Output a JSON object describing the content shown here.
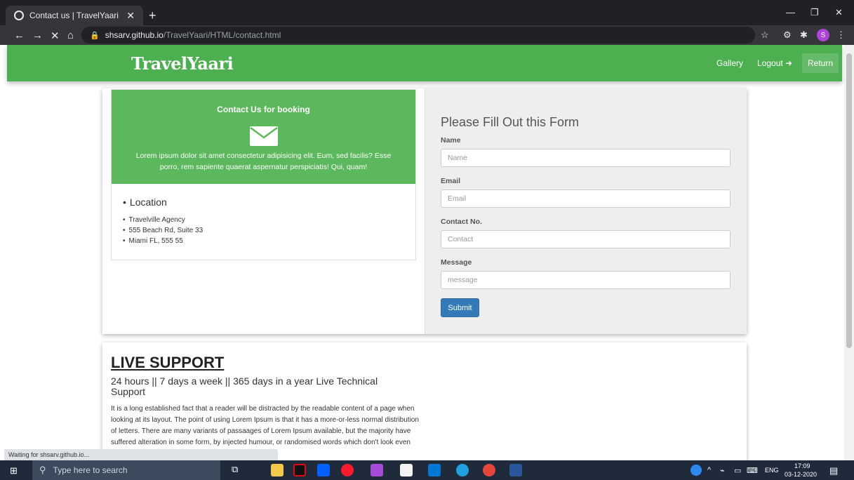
{
  "browser": {
    "tab_title": "Contact us | TravelYaari",
    "new_tab": "+",
    "url_host": "shsarv.github.io",
    "url_path": "/TravelYaari/HTML/contact.html",
    "status_text": "Waiting for shsarv.github.io..."
  },
  "navbar": {
    "brand": "TravelYaari",
    "links": {
      "gallery": "Gallery",
      "logout": "Logout",
      "return": "Return"
    }
  },
  "contact": {
    "box_title": "Contact Us for booking",
    "box_text": "Lorem ipsum dolor sit amet consectetur adipisicing elit. Eum, sed facilis? Esse porro, rem sapiente quaerat aspernatur perspiciatis! Qui, quam!",
    "location_heading": "Location",
    "location_items": [
      "Travelville Agency",
      "555 Beach Rd, Suite 33",
      "Miami FL, 555 55"
    ]
  },
  "form": {
    "title": "Please Fill Out this Form",
    "name_label": "Name",
    "name_placeholder": "Name",
    "email_label": "Email",
    "email_placeholder": "Email",
    "contact_label": "Contact No.",
    "contact_placeholder": "Contact",
    "message_label": "Message",
    "message_placeholder": "message",
    "submit_label": "Submit"
  },
  "support": {
    "title": "LIVE SUPPORT",
    "subtitle": "24 hours || 7 days a week || 365 days in a year Live Technical Support",
    "text": "It is a long established fact that a reader will be distracted by the readable content of a page when looking at its layout. The point of using Lorem Ipsum is that it has a more-or-less normal distribution of letters. There are many variants of passaages of Lorem Ipsum available, but the majority have suffered alteration in some form, by injected humour, or randomised words which don't look even slightly believable. If you are going to use a"
  },
  "taskbar": {
    "search_placeholder": "Type here to search",
    "lang": "ENG",
    "time": "17:09",
    "date": "03-12-2020"
  },
  "colors": {
    "brand_green": "#4caf50",
    "box_green": "#5cb85c",
    "submit_blue": "#337ab7"
  }
}
